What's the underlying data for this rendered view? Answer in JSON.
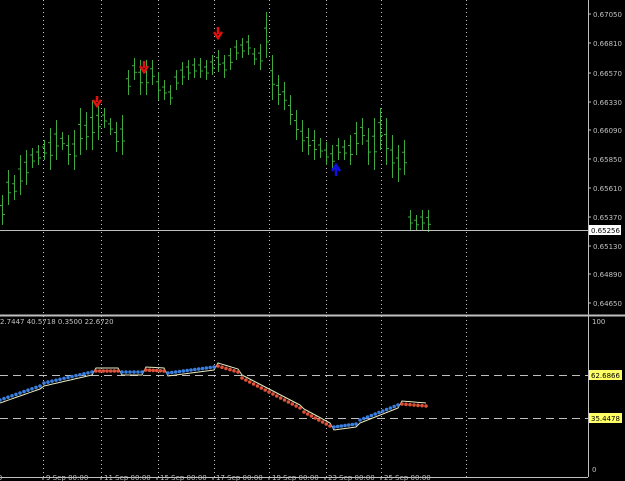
{
  "main_chart": {
    "price_ticks": [
      "0.67050",
      "0.66810",
      "0.66570",
      "0.66330",
      "0.66090",
      "0.65850",
      "0.65610",
      "0.65370",
      "0.65130",
      "0.64890",
      "0.64650"
    ],
    "current_price": "0.65256",
    "colors": {
      "candles": "#3fa83f",
      "arrow_down": "#e01010",
      "arrow_up": "#1010e0",
      "grid": "#bfbfbf",
      "background": "#000000"
    }
  },
  "indicator": {
    "header": "2.7447 40.5718 0.3500 22.6720",
    "scale_ticks": [
      "100",
      "0"
    ],
    "level_high": "62.6866",
    "level_low": "35.4478",
    "colors": {
      "rising_dots": "#3a7fdf",
      "falling_dots": "#e0533a",
      "signal_line": "#e8e8c0",
      "level_tag": "#ffff66"
    }
  },
  "time_axis": [
    "9 Sep 00:00",
    "11 Sep 00:00",
    "15 Sep 00:00",
    "17 Sep 00:00",
    "19 Sep 00:00",
    "23 Sep 00:00",
    "25 Sep 00:00"
  ]
}
